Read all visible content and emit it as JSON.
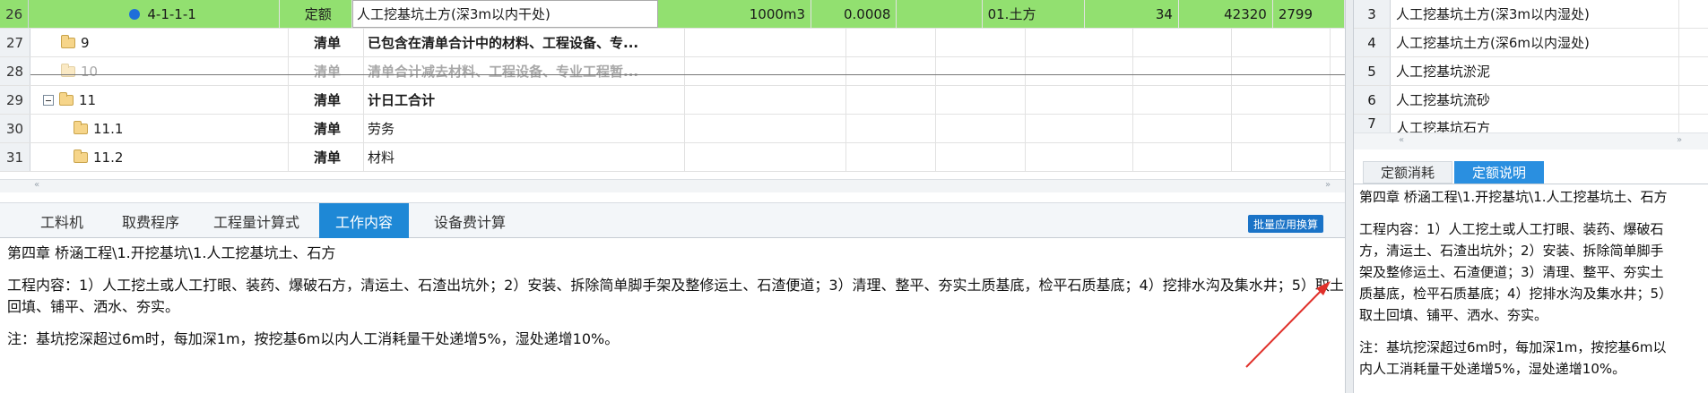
{
  "grid": {
    "rows": [
      {
        "num": "26",
        "code": "4-1-1-1",
        "type": "定额",
        "name": "人工挖基坑土方(深3m以内干处)",
        "unit": "1000m3",
        "qty": "0.0008",
        "category": "01.土方",
        "v1": "34",
        "v2": "42320",
        "v3": "2799"
      },
      {
        "num": "27",
        "code": "9",
        "type": "清单",
        "name": "已包含在清单合计中的材料、工程设备、专..."
      },
      {
        "num": "28",
        "code": "10",
        "type": "清单",
        "name": "清单合计减去材料、工程设备、专业工程暂..."
      },
      {
        "num": "29",
        "code": "11",
        "type": "清单",
        "name": "计日工合计"
      },
      {
        "num": "30",
        "code": "11.1",
        "type": "清单",
        "name": "劳务"
      },
      {
        "num": "31",
        "code": "11.2",
        "type": "清单",
        "name": "材料"
      }
    ]
  },
  "tabs": {
    "items": [
      "工料机",
      "取费程序",
      "工程量计算式",
      "工作内容",
      "设备费计算"
    ],
    "batch_button": "批量应用换算"
  },
  "content": {
    "chapter": "第四章 桥涵工程\\1.开挖基坑\\1.人工挖基坑土、石方",
    "work_line1": "工程内容：1）人工挖土或人工打眼、装药、爆破石方，清运土、石渣出坑外；2）安装、拆除简单脚手架及整修运土、石渣便道；3）清理、整平、夯实土质基底，检平石质基底；4）挖排水沟及集水井；5）取土",
    "work_line2": "回填、铺平、洒水、夯实。",
    "note": "注：基坑挖深超过6m时，每加深1m，按挖基6m以内人工消耗量干处递增5%，湿处递增10%。"
  },
  "right": {
    "rows": [
      {
        "num": "3",
        "name": "人工挖基坑土方(深3m以内湿处)"
      },
      {
        "num": "4",
        "name": "人工挖基坑土方(深6m以内湿处)"
      },
      {
        "num": "5",
        "name": "人工挖基坑淤泥"
      },
      {
        "num": "6",
        "name": "人工挖基坑流砂"
      },
      {
        "num": "7",
        "name": "人工挖基坑石方"
      }
    ],
    "tabs": [
      "定额消耗",
      "定额说明"
    ],
    "chapter": "第四章 桥涵工程\\1.开挖基坑\\1.人工挖基坑土、石方",
    "work_lines": [
      "工程内容：1）人工挖土或人工打眼、装药、爆破石",
      "方，清运土、石渣出坑外；2）安装、拆除简单脚手",
      "架及整修运土、石渣便道；3）清理、整平、夯实土",
      "质基底，检平石质基底；4）挖排水沟及集水井；5）",
      "取土回填、铺平、洒水、夯实。"
    ],
    "note_lines": [
      "注：基坑挖深超过6m时，每加深1m，按挖基6m以",
      "内人工消耗量干处递增5%，湿处递增10%。"
    ]
  },
  "colors": {
    "selected_row": "#92e070",
    "tab_active": "#1e88d6",
    "annotation_arrow": "#e0302a"
  }
}
